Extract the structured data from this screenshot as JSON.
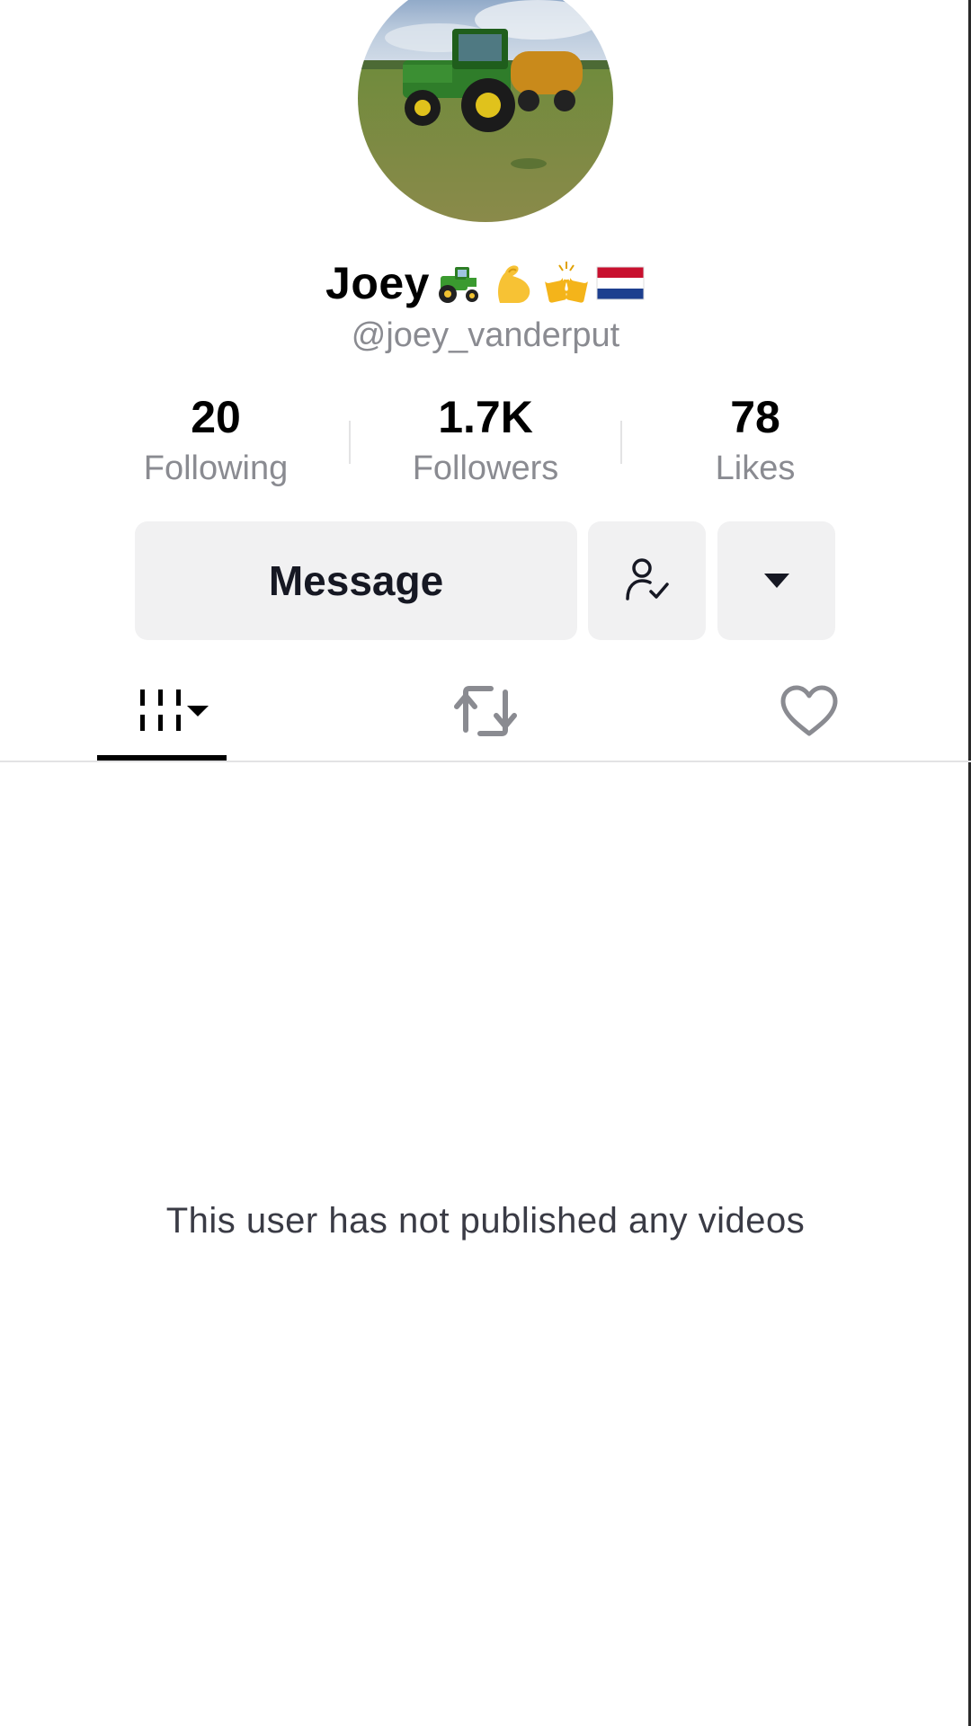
{
  "profile": {
    "avatar_icon": "tractor-field-photo",
    "display_name": "Joey",
    "name_emojis": [
      "tractor-emoji",
      "flexed-biceps-emoji",
      "clinking-beer-mugs-emoji",
      "netherlands-flag-emoji"
    ],
    "username": "@joey_vanderput"
  },
  "stats": {
    "following": {
      "value": "20",
      "label": "Following"
    },
    "followers": {
      "value": "1.7K",
      "label": "Followers"
    },
    "likes": {
      "value": "78",
      "label": "Likes"
    }
  },
  "actions": {
    "message_label": "Message",
    "friend_icon": "person-check-icon",
    "more_icon": "caret-down-icon"
  },
  "tabs": {
    "videos_icon": "video-grid-icon",
    "reposts_icon": "repost-icon",
    "liked_icon": "heart-icon",
    "active": "videos"
  },
  "content": {
    "empty_message": "This user has not published any videos"
  },
  "colors": {
    "primary_text": "#161823",
    "secondary_text": "#8a8b91",
    "button_bg": "#f1f1f2",
    "divider": "#e3e3e4"
  }
}
